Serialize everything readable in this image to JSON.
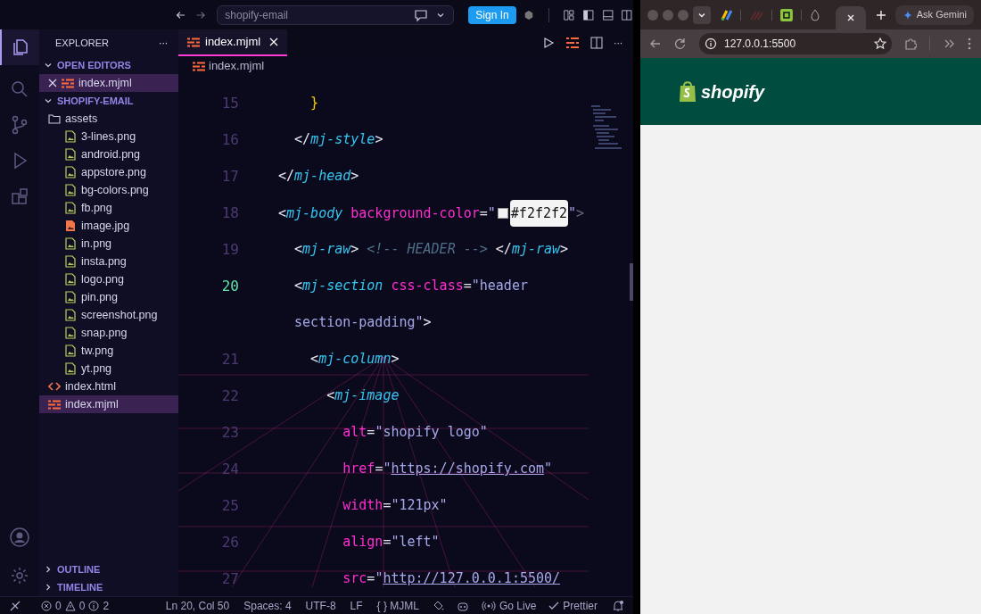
{
  "title_bar": {
    "search": "shopify-email",
    "sign_in": "Sign In"
  },
  "explorer": {
    "title": "EXPLORER",
    "more": "···",
    "open_editors": {
      "label": "OPEN EDITORS",
      "expanded": true,
      "items": [
        {
          "name": "index.mjml",
          "kind": "mjml",
          "selected": true
        }
      ]
    },
    "folder": {
      "label": "SHOPIFY-EMAIL",
      "expanded": true,
      "children": [
        {
          "name": "assets",
          "kind": "folder",
          "selected": false,
          "children": [
            {
              "name": "3-lines.png",
              "kind": "png",
              "selected": false
            },
            {
              "name": "android.png",
              "kind": "png",
              "selected": false
            },
            {
              "name": "appstore.png",
              "kind": "png",
              "selected": false
            },
            {
              "name": "bg-colors.png",
              "kind": "png",
              "selected": false
            },
            {
              "name": "fb.png",
              "kind": "png",
              "selected": false
            },
            {
              "name": "image.jpg",
              "kind": "jpg",
              "selected": false
            },
            {
              "name": "in.png",
              "kind": "png",
              "selected": false
            },
            {
              "name": "insta.png",
              "kind": "png",
              "selected": false
            },
            {
              "name": "logo.png",
              "kind": "png",
              "selected": false
            },
            {
              "name": "pin.png",
              "kind": "png",
              "selected": false
            },
            {
              "name": "screenshot.png",
              "kind": "png",
              "selected": false
            },
            {
              "name": "snap.png",
              "kind": "png",
              "selected": false
            },
            {
              "name": "tw.png",
              "kind": "png",
              "selected": false
            },
            {
              "name": "yt.png",
              "kind": "png",
              "selected": false
            }
          ]
        },
        {
          "name": "index.html",
          "kind": "html",
          "selected": false
        },
        {
          "name": "index.mjml",
          "kind": "mjml",
          "selected": true
        }
      ]
    },
    "sections": [
      {
        "label": "OUTLINE",
        "expanded": false
      },
      {
        "label": "TIMELINE",
        "expanded": false
      }
    ]
  },
  "editor": {
    "tabs": [
      {
        "label": "index.mjml",
        "selected": true
      }
    ],
    "more": "···",
    "breadcrumb": "index.mjml",
    "lines": [
      {
        "number": "15",
        "current": false,
        "tokens": [
          {
            "kind": "brace",
            "text": "    }"
          }
        ]
      },
      {
        "number": "16",
        "current": false,
        "tokens": [
          {
            "kind": "punct",
            "text": "  </"
          },
          {
            "kind": "tag",
            "text": "mj-style"
          },
          {
            "kind": "punct",
            "text": ">"
          }
        ]
      },
      {
        "number": "17",
        "current": false,
        "tokens": [
          {
            "kind": "punct",
            "text": "</"
          },
          {
            "kind": "tag",
            "text": "mj-head"
          },
          {
            "kind": "punct",
            "text": ">"
          }
        ]
      },
      {
        "number": "18",
        "current": false,
        "tokens": [
          {
            "kind": "punct",
            "text": "<"
          },
          {
            "kind": "tag",
            "text": "mj-body "
          },
          {
            "kind": "attr",
            "text": "background-color"
          },
          {
            "kind": "punct",
            "text": "="
          },
          {
            "kind": "str",
            "text": "\""
          },
          {
            "kind": "swatch",
            "color": "#f2f2f2"
          },
          {
            "kind": "highlight",
            "text": "#f2f2f2"
          },
          {
            "kind": "str",
            "text": "\""
          },
          {
            "kind": "dim",
            "text": ">"
          }
        ]
      },
      {
        "number": "19",
        "current": false,
        "tokens": [
          {
            "kind": "punct",
            "text": "  <"
          },
          {
            "kind": "tag",
            "text": "mj-raw"
          },
          {
            "kind": "punct",
            "text": "> "
          },
          {
            "kind": "comment",
            "text": "<!-- HEADER -->"
          },
          {
            "kind": "punct",
            "text": " </"
          },
          {
            "kind": "tag",
            "text": "mj-raw"
          },
          {
            "kind": "punct",
            "text": ">"
          }
        ]
      },
      {
        "number": "20",
        "current": true,
        "tokens": [
          {
            "kind": "punct",
            "text": "  <"
          },
          {
            "kind": "tag",
            "text": "mj-section "
          },
          {
            "kind": "attr",
            "text": "css-class"
          },
          {
            "kind": "punct",
            "text": "="
          },
          {
            "kind": "str",
            "text": "\"header"
          }
        ]
      },
      {
        "tokens": [
          {
            "kind": "str",
            "text": "  section-padding\""
          },
          {
            "kind": "punct",
            "text": ">"
          }
        ]
      },
      {
        "number": "21",
        "current": false,
        "tokens": [
          {
            "kind": "punct",
            "text": "    <"
          },
          {
            "kind": "tag",
            "text": "mj-column"
          },
          {
            "kind": "punct",
            "text": ">"
          }
        ]
      },
      {
        "number": "22",
        "current": false,
        "tokens": [
          {
            "kind": "punct",
            "text": "      <"
          },
          {
            "kind": "tag",
            "text": "mj-image"
          }
        ]
      },
      {
        "number": "23",
        "current": false,
        "tokens": [
          {
            "kind": "attr",
            "text": "        alt"
          },
          {
            "kind": "punct",
            "text": "="
          },
          {
            "kind": "str",
            "text": "\"shopify logo\""
          }
        ]
      },
      {
        "number": "24",
        "current": false,
        "tokens": [
          {
            "kind": "attr",
            "text": "        href"
          },
          {
            "kind": "punct",
            "text": "="
          },
          {
            "kind": "str",
            "text": "\""
          },
          {
            "kind": "link",
            "text": "https://shopify.com"
          },
          {
            "kind": "str",
            "text": "\""
          }
        ]
      },
      {
        "number": "25",
        "current": false,
        "tokens": [
          {
            "kind": "attr",
            "text": "        width"
          },
          {
            "kind": "punct",
            "text": "="
          },
          {
            "kind": "str",
            "text": "\"121px\""
          }
        ]
      },
      {
        "number": "26",
        "current": false,
        "tokens": [
          {
            "kind": "attr",
            "text": "        align"
          },
          {
            "kind": "punct",
            "text": "="
          },
          {
            "kind": "str",
            "text": "\"left\""
          }
        ]
      },
      {
        "number": "27",
        "current": false,
        "tokens": [
          {
            "kind": "attr",
            "text": "        src"
          },
          {
            "kind": "punct",
            "text": "="
          },
          {
            "kind": "str",
            "text": "\""
          },
          {
            "kind": "link",
            "text": "http://127.0.0.1:5500/"
          }
        ]
      }
    ]
  },
  "status_bar": {
    "errors": "0",
    "warnings": "0",
    "infos": "2",
    "items": [
      "Ln 20, Col 50",
      "Spaces: 4",
      "UTF-8",
      "LF",
      "{ } MJML"
    ],
    "go_live": "Go Live",
    "prettier": "Prettier"
  },
  "browser": {
    "ask": "Ask Gemini",
    "url": "127.0.0.1:5500",
    "logo_text": "shopify"
  }
}
